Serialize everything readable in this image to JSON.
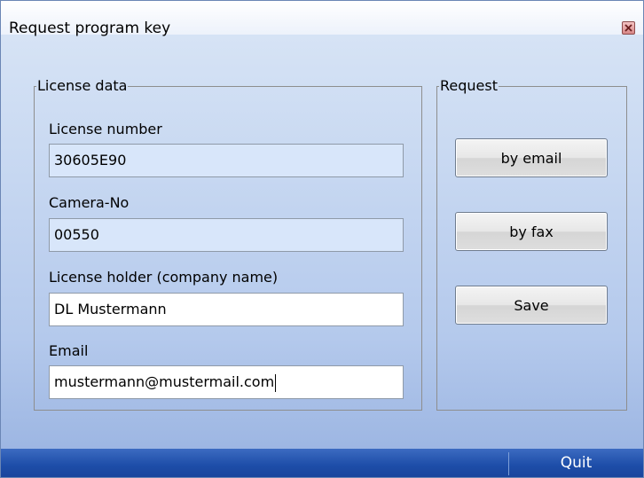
{
  "window": {
    "title": "Request program key",
    "close_icon": "close-icon"
  },
  "license_group": {
    "legend": "License data",
    "license_number": {
      "label": "License number",
      "value": "30605E90"
    },
    "camera_no": {
      "label": "Camera-No",
      "value": "00550"
    },
    "license_holder": {
      "label": "License holder (company name)",
      "value": "DL Mustermann"
    },
    "email": {
      "label": "Email",
      "value": "mustermann@mustermail.com"
    }
  },
  "request_group": {
    "legend": "Request",
    "buttons": [
      {
        "label": "by email"
      },
      {
        "label": "by fax"
      },
      {
        "label": "Save"
      }
    ]
  },
  "statusbar": {
    "quit_label": "Quit"
  },
  "colors": {
    "statusbar": "#1d4da8",
    "readonly_field": "#d8e6fa",
    "close_button": "#d88787"
  }
}
